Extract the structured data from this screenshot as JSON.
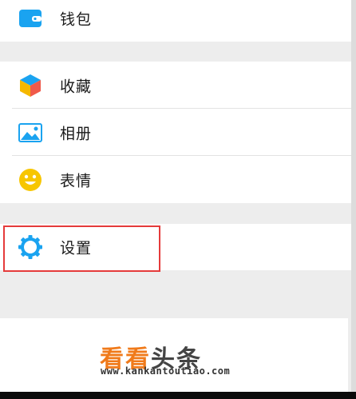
{
  "menu": {
    "wallet": {
      "label": "钱包",
      "icon": "wallet-icon"
    },
    "favorites": {
      "label": "收藏",
      "icon": "cube-icon"
    },
    "album": {
      "label": "相册",
      "icon": "picture-icon"
    },
    "stickers": {
      "label": "表情",
      "icon": "smiley-icon"
    },
    "settings": {
      "label": "设置",
      "icon": "gear-icon"
    }
  },
  "watermark": {
    "title_orange": "看看",
    "title_dark": "头条",
    "url": "www.kankantoutiao.com"
  },
  "colors": {
    "accent_blue": "#1aa3f0",
    "highlight_red": "#e53b3b",
    "watermark_orange": "#f07a1a"
  }
}
